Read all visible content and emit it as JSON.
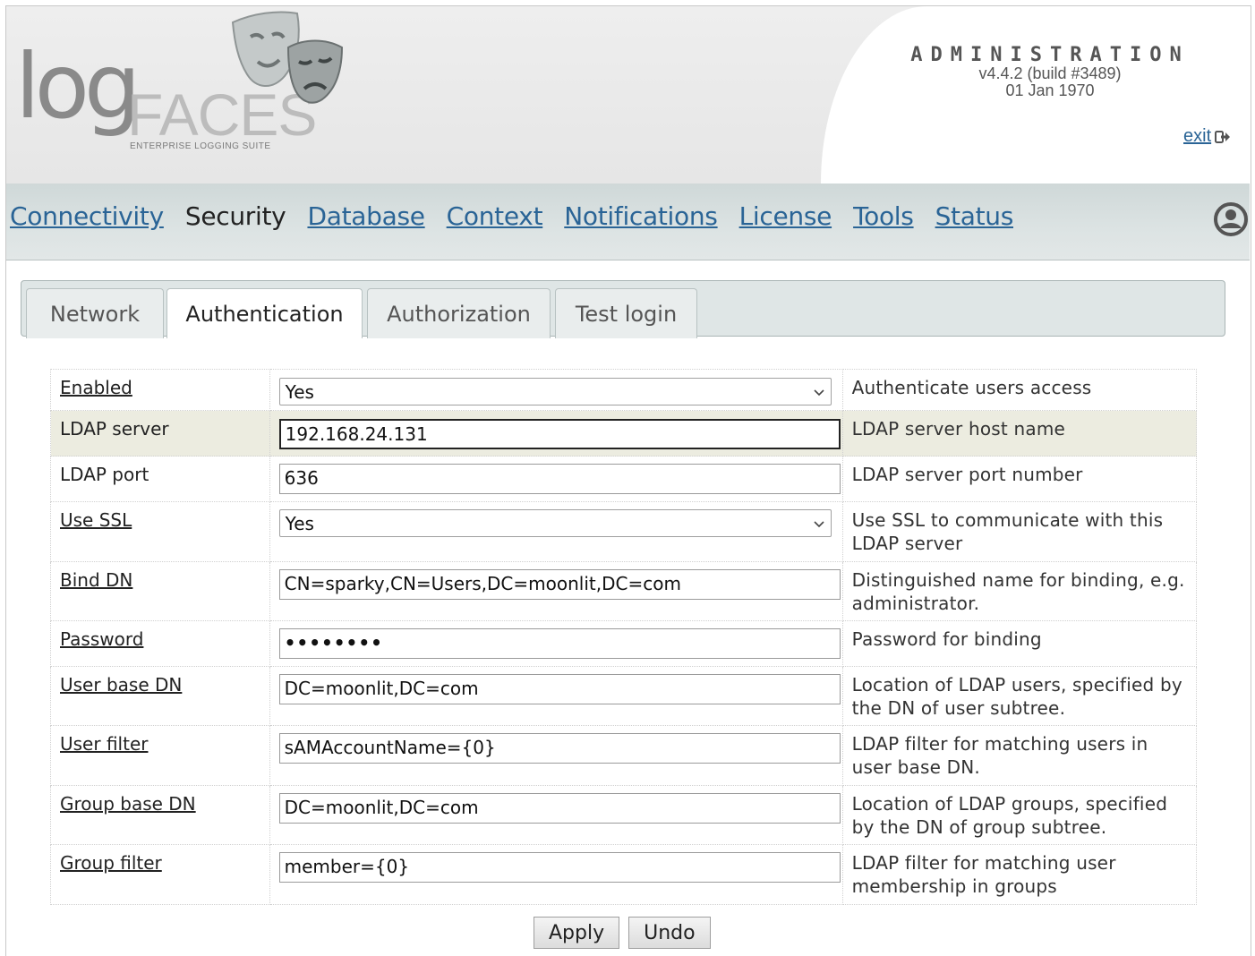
{
  "brand": {
    "logo_main": "log",
    "logo_accent": "FACES",
    "tagline": "ENTERPRISE LOGGING SUITE"
  },
  "header": {
    "title": "ADMINISTRATION",
    "version": "v4.4.2 (build #3489)",
    "date": "01 Jan 1970",
    "exit_label": "exit"
  },
  "nav": {
    "items": [
      {
        "label": "Connectivity"
      },
      {
        "label": "Security"
      },
      {
        "label": "Database"
      },
      {
        "label": "Context"
      },
      {
        "label": "Notifications"
      },
      {
        "label": "License"
      },
      {
        "label": "Tools"
      },
      {
        "label": "Status"
      }
    ],
    "active": "Security"
  },
  "tabs": [
    {
      "label": "Network"
    },
    {
      "label": "Authentication"
    },
    {
      "label": "Authorization"
    },
    {
      "label": "Test login"
    }
  ],
  "active_tab": "Authentication",
  "form": {
    "rows": [
      {
        "label": "Enabled",
        "value": "Yes",
        "description": "Authenticate users access"
      },
      {
        "label": "LDAP server",
        "value": "192.168.24.131",
        "description": "LDAP server host name"
      },
      {
        "label": "LDAP port",
        "value": "636",
        "description": "LDAP server port number"
      },
      {
        "label": "Use SSL",
        "value": "Yes",
        "description": "Use SSL to communicate with this LDAP server"
      },
      {
        "label": "Bind DN",
        "value": "CN=sparky,CN=Users,DC=moonlit,DC=com",
        "description": "Distinguished name for binding, e.g. administrator."
      },
      {
        "label": "Password",
        "value": "••••••••",
        "description": "Password for binding"
      },
      {
        "label": "User base DN",
        "value": "DC=moonlit,DC=com",
        "description": "Location of LDAP users, specified by the DN of user subtree."
      },
      {
        "label": "User filter",
        "value": "sAMAccountName={0}",
        "description": "LDAP filter for matching users in user base DN."
      },
      {
        "label": "Group base DN",
        "value": "DC=moonlit,DC=com",
        "description": "Location of LDAP groups, specified by the DN of group subtree."
      },
      {
        "label": "Group filter",
        "value": "member={0}",
        "description": "LDAP filter for matching user membership in groups"
      }
    ]
  },
  "buttons": {
    "apply": "Apply",
    "undo": "Undo"
  },
  "icons": {
    "exit": "exit-icon",
    "user": "user-icon",
    "dropdown": "chevron-down-icon",
    "logo": "theater-masks-icon"
  },
  "colors": {
    "link": "#2a6496",
    "nav_bg": "#dce3e3",
    "highlight_row": "#ecece0"
  }
}
